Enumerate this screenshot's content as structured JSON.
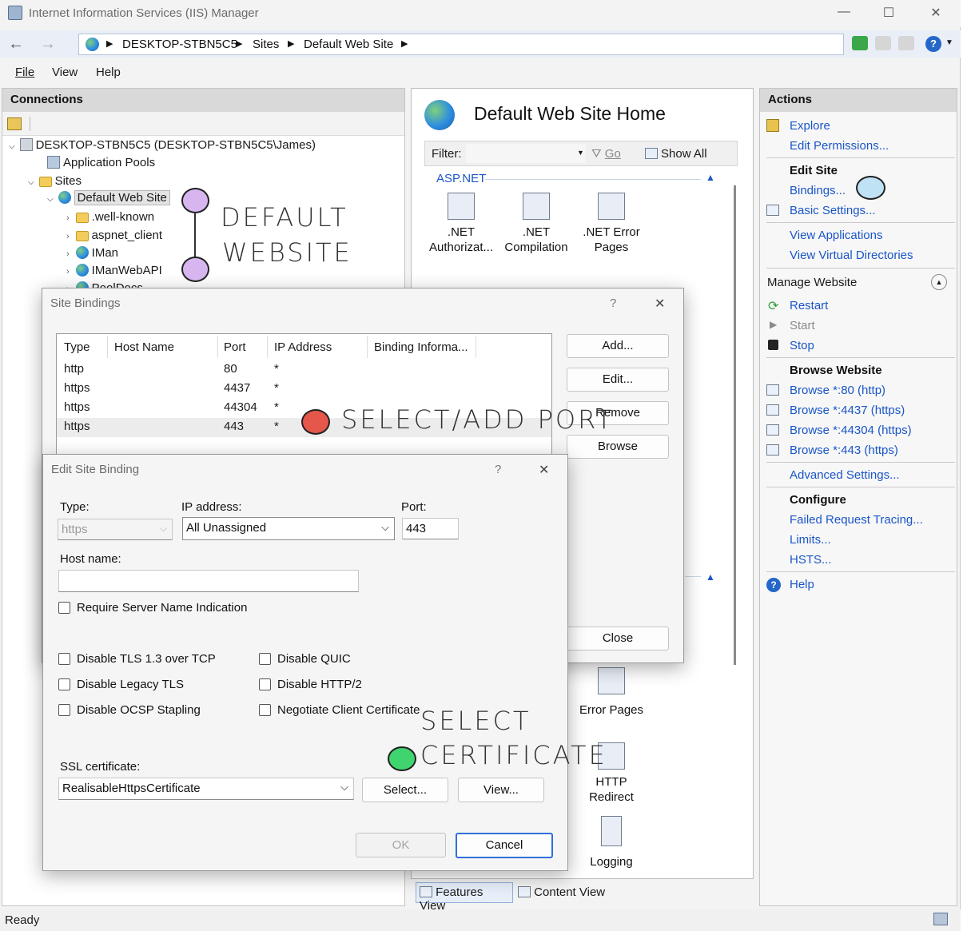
{
  "window": {
    "title": "Internet Information Services (IIS) Manager",
    "controls": {
      "minimize": "—",
      "maximize": "☐",
      "close": "✕"
    }
  },
  "address": {
    "crumbs": [
      "DESKTOP-STBN5C5",
      "Sites",
      "Default Web Site"
    ]
  },
  "menu": {
    "file": "File",
    "view": "View",
    "help": "Help"
  },
  "connections": {
    "header": "Connections",
    "tree": {
      "server": "DESKTOP-STBN5C5 (DESKTOP-STBN5C5\\James)",
      "app_pools": "Application Pools",
      "sites": "Sites",
      "default_site": "Default Web Site",
      "children": [
        ".well-known",
        "aspnet_client",
        "IMan",
        "IManWebAPI",
        "PoolDocs"
      ]
    }
  },
  "center": {
    "title": "Default Web Site Home",
    "filter_label": "Filter:",
    "go": "Go",
    "show_all": "Show All",
    "group_aspnet": "ASP.NET",
    "features": [
      {
        "label1": ".NET",
        "label2": "Authorizat..."
      },
      {
        "label1": ".NET",
        "label2": "Compilation"
      },
      {
        "label1": ".NET Error",
        "label2": "Pages"
      }
    ],
    "error_pages": "Error Pages",
    "http_redirect_1": "HTTP",
    "http_redirect_2": "Redirect",
    "logging": "Logging",
    "features_view": "Features View",
    "content_view": "Content View"
  },
  "actions": {
    "header": "Actions",
    "explore": "Explore",
    "edit_permissions": "Edit Permissions...",
    "edit_site": "Edit Site",
    "bindings": "Bindings...",
    "basic_settings": "Basic Settings...",
    "view_applications": "View Applications",
    "view_virtual_dirs": "View Virtual Directories",
    "manage_website": "Manage Website",
    "restart": "Restart",
    "start": "Start",
    "stop": "Stop",
    "browse_website": "Browse Website",
    "browse_links": [
      "Browse *:80 (http)",
      "Browse *:4437 (https)",
      "Browse *:44304 (https)",
      "Browse *:443 (https)"
    ],
    "advanced_settings": "Advanced Settings...",
    "configure": "Configure",
    "failed_request": "Failed Request Tracing...",
    "limits": "Limits...",
    "hsts": "HSTS...",
    "help": "Help"
  },
  "site_bindings": {
    "title": "Site Bindings",
    "help": "?",
    "close_x": "✕",
    "columns": [
      "Type",
      "Host Name",
      "Port",
      "IP Address",
      "Binding Informa..."
    ],
    "rows": [
      {
        "type": "http",
        "host": "",
        "port": "80",
        "ip": "*",
        "info": ""
      },
      {
        "type": "https",
        "host": "",
        "port": "4437",
        "ip": "*",
        "info": ""
      },
      {
        "type": "https",
        "host": "",
        "port": "44304",
        "ip": "*",
        "info": ""
      },
      {
        "type": "https",
        "host": "",
        "port": "443",
        "ip": "*",
        "info": ""
      }
    ],
    "add": "Add...",
    "edit": "Edit...",
    "remove": "Remove",
    "browse": "Browse",
    "close": "Close"
  },
  "edit_binding": {
    "title": "Edit Site Binding",
    "help": "?",
    "close_x": "✕",
    "type_label": "Type:",
    "type_value": "https",
    "ip_label": "IP address:",
    "ip_value": "All Unassigned",
    "port_label": "Port:",
    "port_value": "443",
    "host_label": "Host name:",
    "host_value": "",
    "sni": "Require Server Name Indication",
    "tls13": "Disable TLS 1.3 over TCP",
    "quic": "Disable QUIC",
    "legacy_tls": "Disable Legacy TLS",
    "http2": "Disable HTTP/2",
    "ocsp": "Disable OCSP Stapling",
    "client_cert": "Negotiate Client Certificate",
    "ssl_label": "SSL certificate:",
    "ssl_value": "RealisableHttpsCertificate",
    "select": "Select...",
    "view": "View...",
    "ok": "OK",
    "cancel": "Cancel"
  },
  "annotations": {
    "default_website_1": "DEFAULT",
    "default_website_2": "WEBSITE",
    "select_add_port": "SELECT/ADD PORT",
    "select_cert_1": "SELECT",
    "select_cert_2": "CERTIFICATE"
  },
  "status": {
    "text": "Ready"
  },
  "colors": {
    "link": "#1a56c8",
    "dot_purple": "#d7b6f0",
    "dot_blue": "#bfe3f4",
    "dot_red": "#e4574a",
    "dot_green": "#3fd46e"
  }
}
